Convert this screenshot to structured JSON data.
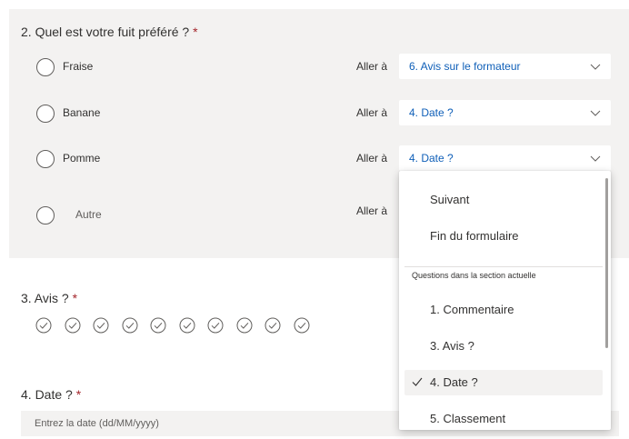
{
  "q2": {
    "title": "2. Quel est votre fuit préféré ?",
    "required": "*",
    "goto_label": "Aller à",
    "options": [
      {
        "label": "Fraise",
        "goto": "6. Avis sur le formateur"
      },
      {
        "label": "Banane",
        "goto": "4. Date ?"
      },
      {
        "label": "Pomme",
        "goto": "4. Date ?"
      },
      {
        "label": "Autre"
      }
    ]
  },
  "q3": {
    "title": "3. Avis ?",
    "required": "*",
    "rating_icon": "check-circle-icon",
    "rating_count": 10
  },
  "q4": {
    "title": "4. Date ?",
    "required": "*",
    "placeholder": "Entrez la date (dd/MM/yyyy)"
  },
  "dropdown": {
    "items": [
      "Suivant",
      "Fin du formulaire"
    ],
    "section_header": "Questions dans la section actuelle",
    "questions": [
      "1. Commentaire",
      "3. Avis ?",
      "4. Date ?",
      "5. Classement"
    ],
    "selected": "4. Date ?"
  },
  "colors": {
    "accent_text": "#0f5fb8",
    "required": "#a4262c",
    "section_bg": "#f3f2f1"
  }
}
